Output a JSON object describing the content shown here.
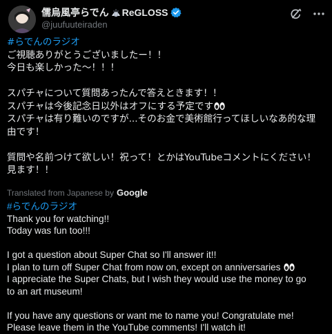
{
  "author": {
    "display_name": "儒烏風亭らでん",
    "name_suffix": "ReGLOSS",
    "handle": "@juufuuteiraden",
    "verified_icon": "verified-badge-icon",
    "emoji_icon": "seashell-emoji-icon"
  },
  "actions": {
    "grok_icon": "grok-icon",
    "more_icon": "more-options-icon"
  },
  "original": {
    "hashtag": "#らでんのラジオ",
    "lines": [
      "ご視聴ありがとうございましたー！！",
      "今日も楽しかった〜！！！",
      "",
      "スパチャについて質問あったんで答えときます！！",
      "スパチャは今後記念日以外はオフにする予定です",
      "スパチャは有り難いのですが...そのお金で美術館行ってほしいなあ的な理",
      "由です！",
      "",
      "質問や名前つけて欲しい！祝って！とかはYouTubeコメントにください！",
      "見ます！！"
    ]
  },
  "translation_label": {
    "text": "Translated from Japanese by",
    "provider": "Google"
  },
  "translation": {
    "hashtag": "#らでんのラジオ",
    "lines": [
      "Thank you for watching!!",
      "Today was fun too!!!",
      "",
      "I got a question about Super Chat so I'll answer it!!",
      "I plan to turn off Super Chat from now on, except on anniversaries",
      "I appreciate the Super Chats, but I wish they would use the money to go",
      "to an art museum!",
      "",
      "If you have any questions or want me to name you! Congratulate me!",
      "Please leave them in the YouTube comments! I'll watch it!"
    ]
  },
  "colors": {
    "background": "#000000",
    "text": "#e7e9ea",
    "muted": "#71767b",
    "link": "#1d9bf0",
    "verified": "#1d9bf0"
  }
}
